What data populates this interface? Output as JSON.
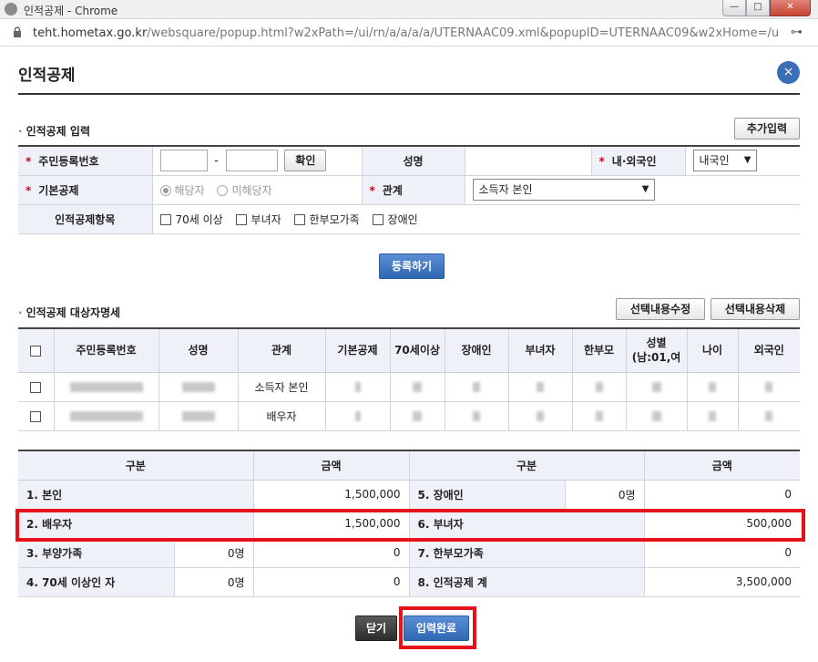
{
  "window": {
    "title": "인적공제 - Chrome",
    "url_host": "teht.hometax.go.kr",
    "url_path": "/websquare/popup.html?w2xPath=/ui/rn/a/a/a/a/UTERNAAC09.xml&popupID=UTERNAAC09&w2xHome=/u..."
  },
  "header": {
    "title": "인적공제",
    "close_symbol": "×"
  },
  "entry": {
    "section_title": "인적공제 입력",
    "add_button": "추가입력",
    "rrn_label": "주민등록번호",
    "rrn_separator": "-",
    "confirm_button": "확인",
    "name_label": "성명",
    "nationality_label": "내·외국인",
    "nationality_value": "내국인",
    "basic_label": "기본공제",
    "basic_options": [
      "해당자",
      "미해당자"
    ],
    "relation_label": "관계",
    "relation_value": "소득자 본인",
    "items_label": "인적공제항목",
    "items": [
      "70세 이상",
      "부녀자",
      "한부모가족",
      "장애인"
    ],
    "required_mark": "*",
    "register_button": "등록하기"
  },
  "list": {
    "section_title": "인적공제 대상자명세",
    "edit_button": "선택내용수정",
    "delete_button": "선택내용삭제",
    "headers": [
      "주민등록번호",
      "성명",
      "관계",
      "기본공제",
      "70세이상",
      "장애인",
      "부녀자",
      "한부모",
      "성별",
      "나이",
      "외국인"
    ],
    "gender_sub": "(남:01,여",
    "rows": [
      {
        "relation": "소득자 본인"
      },
      {
        "relation": "배우자"
      }
    ]
  },
  "summary": {
    "col_category": "구분",
    "col_amount": "금액",
    "rows": [
      {
        "left_label": "1. 본인",
        "left_count": "",
        "left_amount": "1,500,000",
        "right_label": "5. 장애인",
        "right_count": "0명",
        "right_amount": "0"
      },
      {
        "left_label": "2. 배우자",
        "left_count": "",
        "left_amount": "1,500,000",
        "right_label": "6. 부녀자",
        "right_count": "",
        "right_amount": "500,000"
      },
      {
        "left_label": "3. 부양가족",
        "left_count": "0명",
        "left_amount": "0",
        "right_label": "7. 한부모가족",
        "right_count": "",
        "right_amount": "0"
      },
      {
        "left_label": "4. 70세 이상인 자",
        "left_count": "0명",
        "left_amount": "0",
        "right_label": "8. 인적공제 계",
        "right_count": "",
        "right_amount": "3,500,000"
      }
    ]
  },
  "footer": {
    "close_button": "닫기",
    "complete_button": "입력완료"
  },
  "colors": {
    "accent_blue": "#2f67b4",
    "highlight_red": "#e8101a",
    "label_bg": "#eef2f8"
  }
}
